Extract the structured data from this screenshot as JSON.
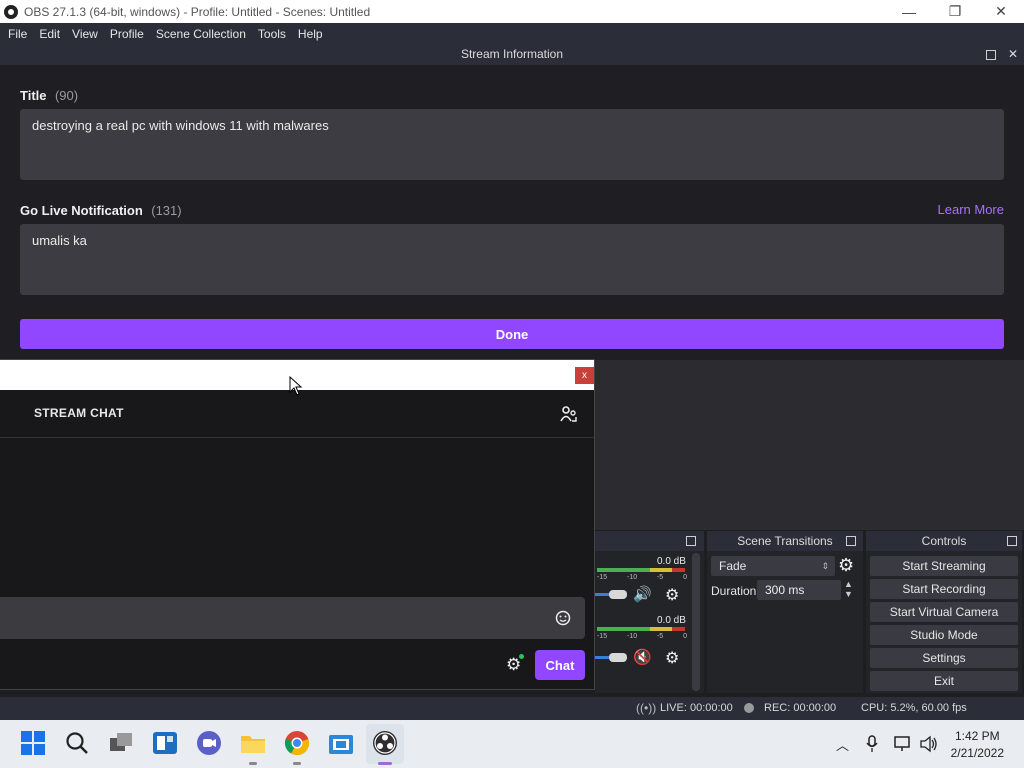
{
  "window": {
    "title": "OBS 27.1.3 (64-bit, windows) - Profile: Untitled - Scenes: Untitled",
    "minimize": "—",
    "maximize": "❐",
    "close": "✕"
  },
  "menu": [
    "File",
    "Edit",
    "View",
    "Profile",
    "Scene Collection",
    "Tools",
    "Help"
  ],
  "stream_info": {
    "header": "Stream Information",
    "title_label": "Title",
    "title_count": "(90)",
    "title_value": "destroying a real pc with windows 11 with malwares",
    "notif_label": "Go Live Notification",
    "notif_count": "(131)",
    "learn_more": "Learn More",
    "notif_value": "umalis ka",
    "done": "Done"
  },
  "chat": {
    "close": "x",
    "header": "STREAM CHAT",
    "chat_button": "Chat"
  },
  "mixer": {
    "track1_db": "0.0 dB",
    "track2_db": "0.0 dB",
    "ticks": [
      "-15",
      "-10",
      "-5",
      "0"
    ]
  },
  "transitions": {
    "header": "Scene Transitions",
    "selected": "Fade",
    "duration_label": "Duration",
    "duration_value": "300 ms"
  },
  "controls": {
    "header": "Controls",
    "buttons": [
      "Start Streaming",
      "Start Recording",
      "Start Virtual Camera",
      "Studio Mode",
      "Settings",
      "Exit"
    ]
  },
  "status": {
    "live": "LIVE: 00:00:00",
    "rec": "REC: 00:00:00",
    "cpu": "CPU: 5.2%, 60.00 fps"
  },
  "taskbar": {
    "time": "1:42 PM",
    "date": "2/21/2022"
  },
  "colors": {
    "accent": "#9147ff",
    "learn_more": "#a970ff"
  }
}
